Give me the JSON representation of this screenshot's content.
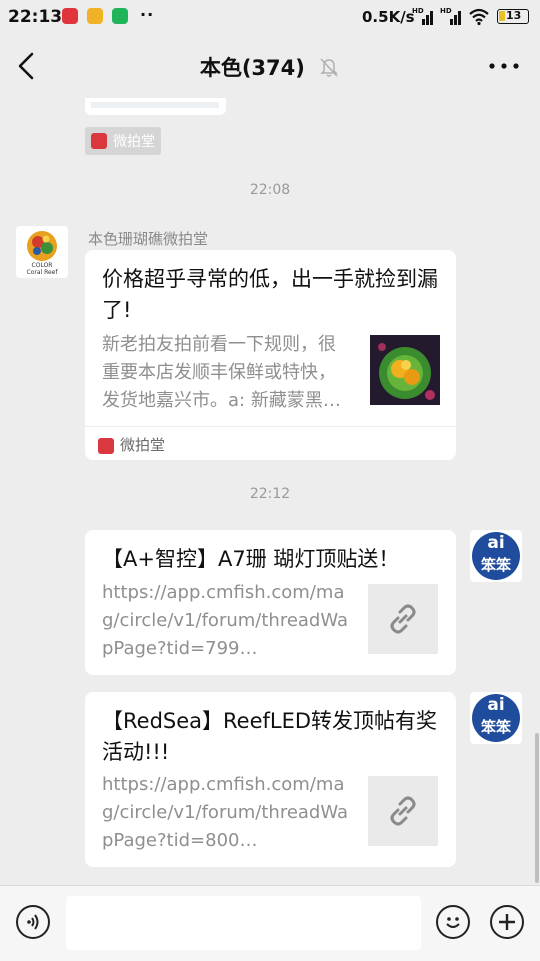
{
  "status": {
    "time": "22:13",
    "dots": "··",
    "network_speed": "0.5K/s",
    "hd1": "HD",
    "hd2": "HD",
    "battery": "13"
  },
  "header": {
    "title": "本色(374)"
  },
  "messages": {
    "prev_source": "微拍堂",
    "time1": "22:08",
    "sender1": "本色珊瑚礁微拍堂",
    "card1": {
      "title": "价格超乎寻常的低，出一手就捡到漏了!",
      "desc": "新老拍友拍前看一下规则，很重要本店发顺丰保鲜或特快，发货地嘉兴市。a: 新藏蒙黑…",
      "source": "微拍堂"
    },
    "time2": "22:12",
    "card2": {
      "title": "【A+智控】A7珊 瑚灯顶贴送！",
      "url": "https://app.cmfish.com/mag/circle/v1/forum/threadWapPage?tid=799…"
    },
    "card3": {
      "title": "【RedSea】ReefLED转发顶帖有奖活动!!!",
      "url": "https://app.cmfish.com/mag/circle/v1/forum/threadWapPage?tid=800…"
    }
  },
  "avatar": {
    "coral_brand_line1": "COLOR",
    "coral_brand_line2": "Coral Reef",
    "ai_letters": "ai",
    "ai_chars": "笨笨"
  },
  "colors": {
    "background": "#ededed",
    "card": "#ffffff",
    "weipaitang_red": "#d9383f",
    "ai_avatar_blue": "#1f4c9c"
  }
}
